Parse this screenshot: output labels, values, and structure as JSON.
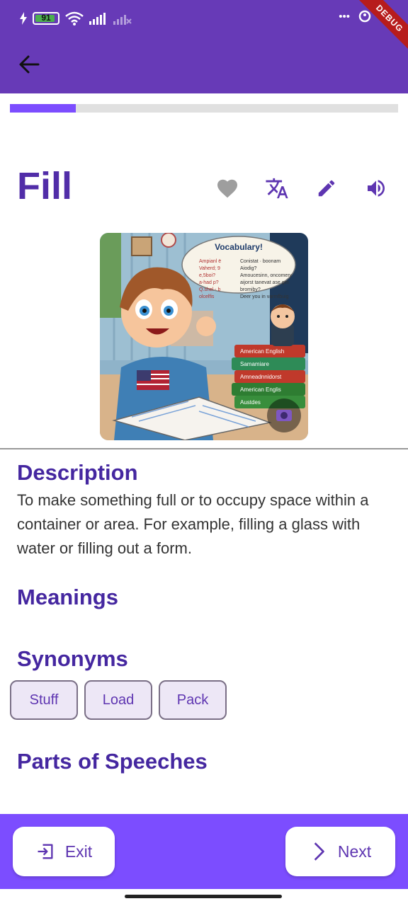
{
  "status_bar": {
    "battery": "91",
    "battery_level": 0.91,
    "right_text": "•••"
  },
  "debug_banner": "DEBUG",
  "progress": {
    "fraction": 0.17
  },
  "word": "Fill",
  "actions": {
    "favorite_icon": "heart-icon",
    "translate_icon": "translate-icon",
    "edit_icon": "pencil-icon",
    "speak_icon": "speaker-icon"
  },
  "illustration": {
    "speech_title": "Vocabulary!",
    "book_labels": [
      "American English",
      "Samamiare",
      "Amneadnnidorst",
      "American Englis",
      "Austdes"
    ]
  },
  "description": {
    "heading": "Description",
    "text": "To make something full or to occupy space within a container or area. For example, filling a glass with water or filling out a form."
  },
  "meanings": {
    "heading": "Meanings"
  },
  "synonyms": {
    "heading": "Synonyms",
    "items": [
      "Stuff",
      "Load",
      "Pack"
    ]
  },
  "parts_of_speech": {
    "heading": "Parts of Speeches"
  },
  "bottom_bar": {
    "exit_label": "Exit",
    "next_label": "Next"
  },
  "colors": {
    "primary": "#673ab7",
    "accent": "#7c4dff",
    "heading": "#4527a0"
  }
}
